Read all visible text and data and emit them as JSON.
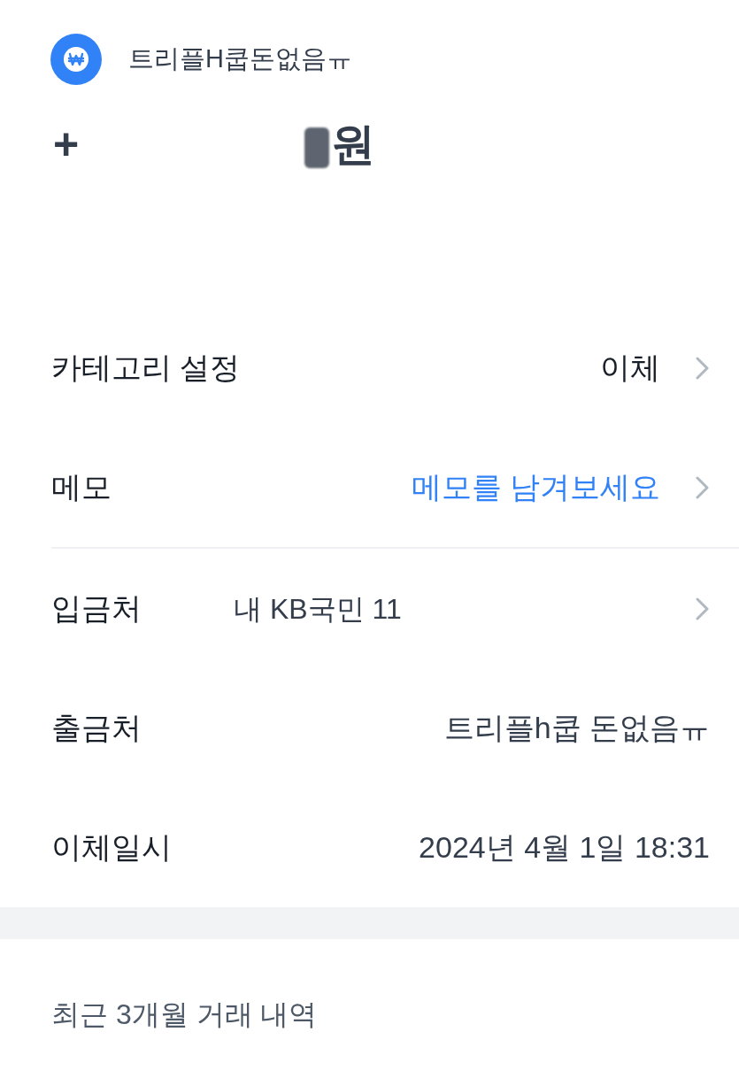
{
  "header": {
    "account_name": "트리플H쿱돈없음ㅠ"
  },
  "amount": {
    "sign": "+",
    "unit": "원"
  },
  "summary_rows": [
    {
      "kind": "link",
      "label": "카테고리 설정",
      "value": "이체"
    },
    {
      "kind": "input",
      "label": "메모",
      "placeholder": "메모를 남겨보세요"
    }
  ],
  "detail_rows": [
    {
      "kind": "account",
      "label": "입금처",
      "value": "내 KB국민 11"
    },
    {
      "kind": "plain",
      "label": "출금처",
      "value": "트리플h쿱 돈없음ㅠ"
    },
    {
      "kind": "plain",
      "label": "이체일시",
      "value": "2024년 4월 1일 18:31"
    }
  ],
  "recent": {
    "title": "최근 3개월 거래 내역"
  }
}
